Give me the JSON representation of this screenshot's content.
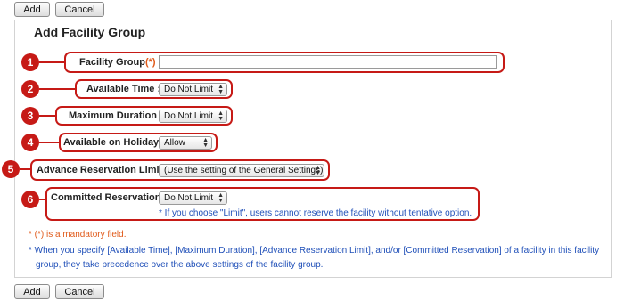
{
  "toolbar": {
    "add_label": "Add",
    "cancel_label": "Cancel"
  },
  "footer_toolbar": {
    "add_label": "Add",
    "cancel_label": "Cancel"
  },
  "page_title": "Add Facility Group",
  "fields": {
    "facility_group": {
      "number": "1",
      "label": "Facility Group",
      "required_mark": "(*)",
      "colon": ":",
      "value": ""
    },
    "available_time": {
      "number": "2",
      "label": "Available Time",
      "colon": ":",
      "selected": "Do Not Limit"
    },
    "maximum_duration": {
      "number": "3",
      "label": "Maximum Duration",
      "colon": ":",
      "selected": "Do Not Limit"
    },
    "available_on_holiday": {
      "number": "4",
      "label": "Available on Holiday",
      "colon": ":",
      "selected": "Allow"
    },
    "advance_reservation_limit": {
      "number": "5",
      "label": "Advance Reservation Limit",
      "colon": ":",
      "selected": "(Use the setting of the General Settings)"
    },
    "committed_reservation": {
      "number": "6",
      "label": "Committed Reservation",
      "colon": ":",
      "selected": "Do Not Limit",
      "hint": "* If you choose \"Limit\", users cannot reserve the facility without tentative option."
    }
  },
  "notes": {
    "mandatory": "* (*) is a mandatory field.",
    "precedence_line1": "* When you specify [Available Time], [Maximum Duration], [Advance Reservation Limit], and/or [Committed Reservation] of a facility in this facility",
    "precedence_line2": "group, they take precedence over the above settings of the facility group."
  },
  "colors": {
    "marker": "#c61a16",
    "required": "#e05a1a",
    "link_blue": "#1f4fb8"
  },
  "icons": {
    "select_arrows": "up-down-arrows-icon"
  }
}
